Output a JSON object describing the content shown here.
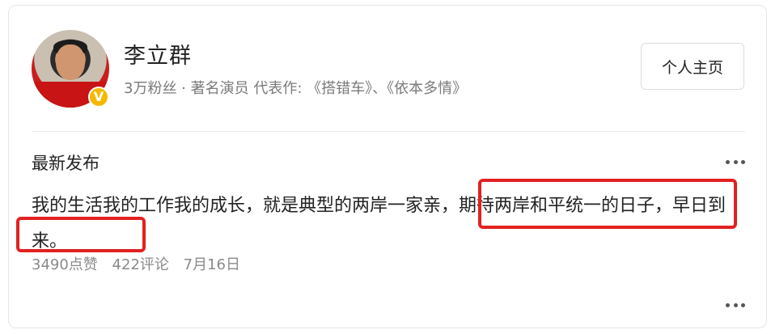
{
  "profile": {
    "name": "李立群",
    "meta": "3万粉丝 · 著名演员 代表作: 《搭错车》、《依本多情》",
    "button_label": "个人主页"
  },
  "post": {
    "section_title": "最新发布",
    "text": "我的生活我的工作我的成长，就是典型的两岸一家亲，期待两岸和平统一的日子，早日到来。",
    "likes": "3490点赞",
    "comments": "422评论",
    "date": "7月16日"
  },
  "colors": {
    "highlight": "#e32020",
    "verify_badge": "#f5b800"
  }
}
